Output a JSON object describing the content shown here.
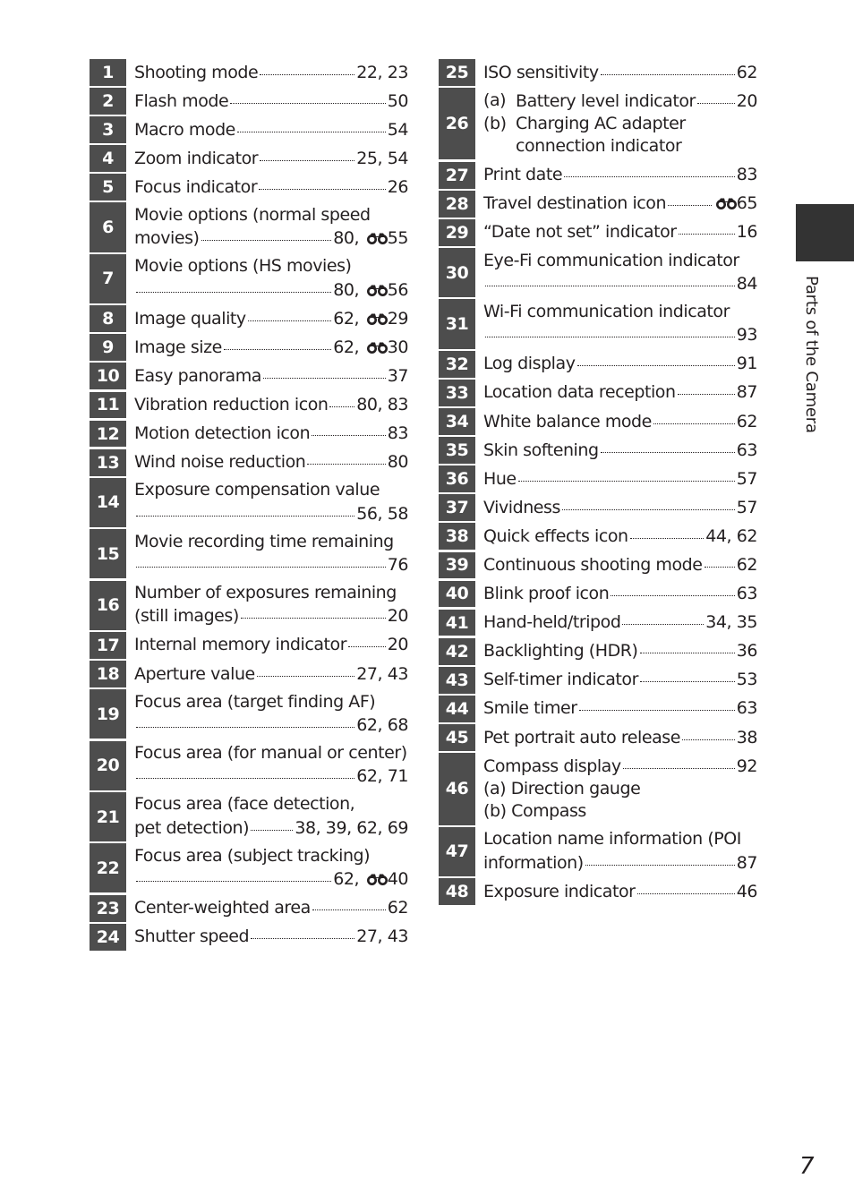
{
  "side_tab": {
    "label": "Parts of the Camera"
  },
  "page_number": "7",
  "reference_icon": "binoculars-icon",
  "left_column": [
    {
      "num": "1",
      "lines": [
        {
          "text": "Shooting mode",
          "pages": "22, 23"
        }
      ]
    },
    {
      "num": "2",
      "lines": [
        {
          "text": "Flash mode",
          "pages": "50"
        }
      ]
    },
    {
      "num": "3",
      "lines": [
        {
          "text": "Macro mode",
          "pages": "54"
        }
      ]
    },
    {
      "num": "4",
      "lines": [
        {
          "text": "Zoom indicator",
          "pages": "25, 54"
        }
      ]
    },
    {
      "num": "5",
      "lines": [
        {
          "text": "Focus indicator",
          "pages": "26"
        }
      ]
    },
    {
      "num": "6",
      "lines": [
        {
          "text": "Movie options (normal speed"
        },
        {
          "text": "movies)",
          "pages": "80, ",
          "ref": "55"
        }
      ]
    },
    {
      "num": "7",
      "lines": [
        {
          "text": "Movie options (HS movies)"
        },
        {
          "text": "",
          "pages": "80, ",
          "ref": "56"
        }
      ]
    },
    {
      "num": "8",
      "lines": [
        {
          "text": "Image quality",
          "pages": "62, ",
          "ref": "29"
        }
      ]
    },
    {
      "num": "9",
      "lines": [
        {
          "text": "Image size",
          "pages": "62, ",
          "ref": "30"
        }
      ]
    },
    {
      "num": "10",
      "lines": [
        {
          "text": "Easy panorama",
          "pages": "37"
        }
      ]
    },
    {
      "num": "11",
      "lines": [
        {
          "text": "Vibration reduction icon",
          "pages": "80, 83"
        }
      ]
    },
    {
      "num": "12",
      "lines": [
        {
          "text": "Motion detection icon",
          "pages": "83"
        }
      ]
    },
    {
      "num": "13",
      "lines": [
        {
          "text": "Wind noise reduction",
          "pages": "80"
        }
      ]
    },
    {
      "num": "14",
      "lines": [
        {
          "text": "Exposure compensation value"
        },
        {
          "text": "",
          "pages": "56, 58"
        }
      ]
    },
    {
      "num": "15",
      "lines": [
        {
          "text": "Movie recording time remaining"
        },
        {
          "text": "",
          "pages": "76"
        }
      ]
    },
    {
      "num": "16",
      "lines": [
        {
          "text": "Number of exposures remaining"
        },
        {
          "text": "(still images)",
          "pages": "20"
        }
      ]
    },
    {
      "num": "17",
      "lines": [
        {
          "text": "Internal memory indicator",
          "pages": "20"
        }
      ]
    },
    {
      "num": "18",
      "lines": [
        {
          "text": "Aperture value",
          "pages": "27, 43"
        }
      ]
    },
    {
      "num": "19",
      "lines": [
        {
          "text": "Focus area (target finding AF)"
        },
        {
          "text": "",
          "pages": "62, 68"
        }
      ]
    },
    {
      "num": "20",
      "lines": [
        {
          "text": "Focus area (for manual or center)"
        },
        {
          "text": "",
          "pages": "62, 71"
        }
      ]
    },
    {
      "num": "21",
      "lines": [
        {
          "text": "Focus area (face detection,"
        },
        {
          "text": "pet detection)",
          "pages": "38, 39, 62, 69"
        }
      ]
    },
    {
      "num": "22",
      "lines": [
        {
          "text": "Focus area (subject tracking)"
        },
        {
          "text": "",
          "pages": "62, ",
          "ref": "40"
        }
      ]
    },
    {
      "num": "23",
      "lines": [
        {
          "text": "Center-weighted area",
          "pages": "62"
        }
      ]
    },
    {
      "num": "24",
      "lines": [
        {
          "text": "Shutter speed",
          "pages": "27, 43"
        }
      ]
    }
  ],
  "right_column": [
    {
      "num": "25",
      "lines": [
        {
          "text": "ISO sensitivity",
          "pages": "62"
        }
      ]
    },
    {
      "num": "26",
      "subitems": [
        {
          "label": "(a)",
          "lines": [
            {
              "text": "Battery level indicator",
              "pages": "20"
            }
          ]
        },
        {
          "label": "(b)",
          "lines": [
            {
              "text": "Charging AC adapter"
            },
            {
              "text": "connection indicator"
            }
          ]
        }
      ]
    },
    {
      "num": "27",
      "lines": [
        {
          "text": "Print date",
          "pages": "83"
        }
      ]
    },
    {
      "num": "28",
      "lines": [
        {
          "text": "Travel destination icon",
          "pages": "",
          "ref": "65"
        }
      ]
    },
    {
      "num": "29",
      "lines": [
        {
          "text": "“Date not set” indicator",
          "pages": "16"
        }
      ]
    },
    {
      "num": "30",
      "lines": [
        {
          "text": "Eye-Fi communication indicator"
        },
        {
          "text": "",
          "pages": "84"
        }
      ]
    },
    {
      "num": "31",
      "lines": [
        {
          "text": "Wi-Fi communication indicator"
        },
        {
          "text": "",
          "pages": "93"
        }
      ]
    },
    {
      "num": "32",
      "lines": [
        {
          "text": "Log display",
          "pages": "91"
        }
      ]
    },
    {
      "num": "33",
      "lines": [
        {
          "text": "Location data reception",
          "pages": "87"
        }
      ]
    },
    {
      "num": "34",
      "lines": [
        {
          "text": "White balance mode",
          "pages": "62"
        }
      ]
    },
    {
      "num": "35",
      "lines": [
        {
          "text": "Skin softening",
          "pages": "63"
        }
      ]
    },
    {
      "num": "36",
      "lines": [
        {
          "text": "Hue",
          "pages": "57"
        }
      ]
    },
    {
      "num": "37",
      "lines": [
        {
          "text": "Vividness",
          "pages": "57"
        }
      ]
    },
    {
      "num": "38",
      "lines": [
        {
          "text": "Quick effects icon",
          "pages": "44, 62"
        }
      ]
    },
    {
      "num": "39",
      "lines": [
        {
          "text": "Continuous shooting mode",
          "pages": "62"
        }
      ]
    },
    {
      "num": "40",
      "lines": [
        {
          "text": "Blink proof icon",
          "pages": "63"
        }
      ]
    },
    {
      "num": "41",
      "lines": [
        {
          "text": "Hand-held/tripod",
          "pages": "34, 35"
        }
      ]
    },
    {
      "num": "42",
      "lines": [
        {
          "text": "Backlighting (HDR)",
          "pages": "36"
        }
      ]
    },
    {
      "num": "43",
      "lines": [
        {
          "text": "Self-timer indicator",
          "pages": "53"
        }
      ]
    },
    {
      "num": "44",
      "lines": [
        {
          "text": "Smile timer",
          "pages": "63"
        }
      ]
    },
    {
      "num": "45",
      "lines": [
        {
          "text": "Pet portrait auto release",
          "pages": "38"
        }
      ]
    },
    {
      "num": "46",
      "lines": [
        {
          "text": "Compass display",
          "pages": "92"
        },
        {
          "text": "(a) Direction gauge"
        },
        {
          "text": "(b) Compass"
        }
      ]
    },
    {
      "num": "47",
      "lines": [
        {
          "text": "Location name information (POI"
        },
        {
          "text": "information)",
          "pages": "87"
        }
      ]
    },
    {
      "num": "48",
      "lines": [
        {
          "text": "Exposure indicator",
          "pages": "46"
        }
      ]
    }
  ]
}
